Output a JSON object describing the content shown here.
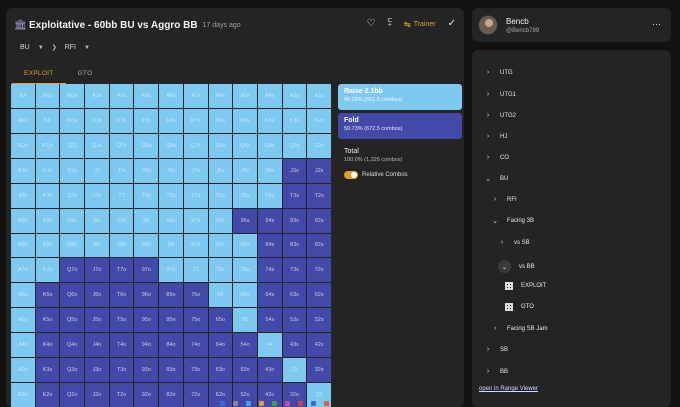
{
  "header": {
    "title": "Exploitative - 60bb BU vs Aggro BB",
    "subtitle": "17 days ago",
    "trainer_label": "Trainer"
  },
  "breadcrumb": {
    "position": "BU",
    "action": "RFI"
  },
  "tabs": [
    {
      "label": "EXPLOIT",
      "active": true
    },
    {
      "label": "GTO",
      "active": false
    }
  ],
  "grid": {
    "rows": [
      [
        "AA",
        "AKs",
        "AQs",
        "AJs",
        "ATs",
        "A9s",
        "A8s",
        "A7s",
        "A6s",
        "A5s",
        "A4s",
        "A3s",
        "A2s"
      ],
      [
        "AKo",
        "KK",
        "KQs",
        "KJs",
        "KTs",
        "K9s",
        "K8s",
        "K7s",
        "K6s",
        "K5s",
        "K4s",
        "K3s",
        "K2s"
      ],
      [
        "AQo",
        "KQo",
        "QQ",
        "QJs",
        "QTs",
        "Q9s",
        "Q8s",
        "Q7s",
        "Q6s",
        "Q5s",
        "Q4s",
        "Q3s",
        "Q2s"
      ],
      [
        "AJo",
        "KJo",
        "QJo",
        "JJ",
        "JTs",
        "J9s",
        "J8s",
        "J7s",
        "J6s",
        "J5s",
        "J4s",
        "J3s",
        "J2s"
      ],
      [
        "ATo",
        "KTo",
        "QTo",
        "JTo",
        "TT",
        "T9s",
        "T8s",
        "T7s",
        "T6s",
        "T5s",
        "T4s",
        "T3s",
        "T2s"
      ],
      [
        "A9o",
        "K9o",
        "Q9o",
        "J9o",
        "T9o",
        "99",
        "98s",
        "97s",
        "96s",
        "95s",
        "94s",
        "93s",
        "92s"
      ],
      [
        "A8o",
        "K8o",
        "Q8o",
        "J8o",
        "T8o",
        "98o",
        "88",
        "87s",
        "86s",
        "85s",
        "84s",
        "83s",
        "82s"
      ],
      [
        "A7o",
        "K7o",
        "Q7o",
        "J7o",
        "T7o",
        "97o",
        "87o",
        "77",
        "76s",
        "75s",
        "74s",
        "73s",
        "72s"
      ],
      [
        "A6o",
        "K6o",
        "Q6o",
        "J6o",
        "T6o",
        "96o",
        "86o",
        "76o",
        "66",
        "65s",
        "64s",
        "63s",
        "62s"
      ],
      [
        "A5o",
        "K5o",
        "Q5o",
        "J5o",
        "T5o",
        "95o",
        "85o",
        "75o",
        "65o",
        "55",
        "54s",
        "53s",
        "52s"
      ],
      [
        "A4o",
        "K4o",
        "Q4o",
        "J4o",
        "T4o",
        "94o",
        "84o",
        "74o",
        "64o",
        "54o",
        "44",
        "43s",
        "42s"
      ],
      [
        "A3o",
        "K3o",
        "Q3o",
        "J3o",
        "T3o",
        "93o",
        "83o",
        "73o",
        "63o",
        "53o",
        "43o",
        "33",
        "32s"
      ],
      [
        "A2o",
        "K2o",
        "Q2o",
        "J2o",
        "T2o",
        "92o",
        "82o",
        "72o",
        "62o",
        "52o",
        "42o",
        "32o",
        "22"
      ]
    ],
    "fold_map": [
      "0000000000000",
      "0000000000000",
      "0000000000000",
      "0000000000011",
      "0000000000011",
      "0000000001111",
      "0000000000111",
      "0011110000111",
      "0111111100111",
      "0111111110111",
      "0111111111011",
      "0111111111101",
      "0111111111110"
    ],
    "colors": {
      "raise": "#7ec9ef",
      "fold": "#4249a8"
    }
  },
  "legend": {
    "raise": {
      "name": "Raise 2.1bb",
      "pct": "49.26% (651.5 combos)"
    },
    "fold": {
      "name": "Fold",
      "pct": "50.73% (672.5 combos)"
    },
    "total": {
      "label": "Total",
      "value": "100.0% (1,326 combos)"
    },
    "toggle_label": "Relative Combos"
  },
  "user": {
    "name": "Bencb",
    "handle": "@Bencb789"
  },
  "tree": [
    {
      "label": "UTG",
      "indent": 0,
      "icon": "chevron-right"
    },
    {
      "label": "UTG1",
      "indent": 0,
      "icon": "chevron-right"
    },
    {
      "label": "UTG2",
      "indent": 0,
      "icon": "chevron-right"
    },
    {
      "label": "HJ",
      "indent": 0,
      "icon": "chevron-right"
    },
    {
      "label": "CO",
      "indent": 0,
      "icon": "chevron-right"
    },
    {
      "label": "BU",
      "indent": 0,
      "icon": "chevron-down"
    },
    {
      "label": "RFI",
      "indent": 1,
      "icon": "chevron-right"
    },
    {
      "label": "Facing 3B",
      "indent": 1,
      "icon": "chevron-down"
    },
    {
      "label": "vs SB",
      "indent": 2,
      "icon": "chevron-right"
    },
    {
      "label": "vs BB",
      "indent": 2,
      "icon": "chevron-down-circle"
    },
    {
      "label": "EXPLOIT",
      "indent": 3,
      "icon": "grid-icon"
    },
    {
      "label": "GTO",
      "indent": 3,
      "icon": "grid-icon"
    },
    {
      "label": "Facing SB Jam",
      "indent": 1,
      "icon": "chevron-right"
    },
    {
      "label": "SB",
      "indent": 0,
      "icon": "chevron-right"
    },
    {
      "label": "BB",
      "indent": 0,
      "icon": "chevron-right"
    }
  ],
  "open_link": "open in Range Viewer"
}
